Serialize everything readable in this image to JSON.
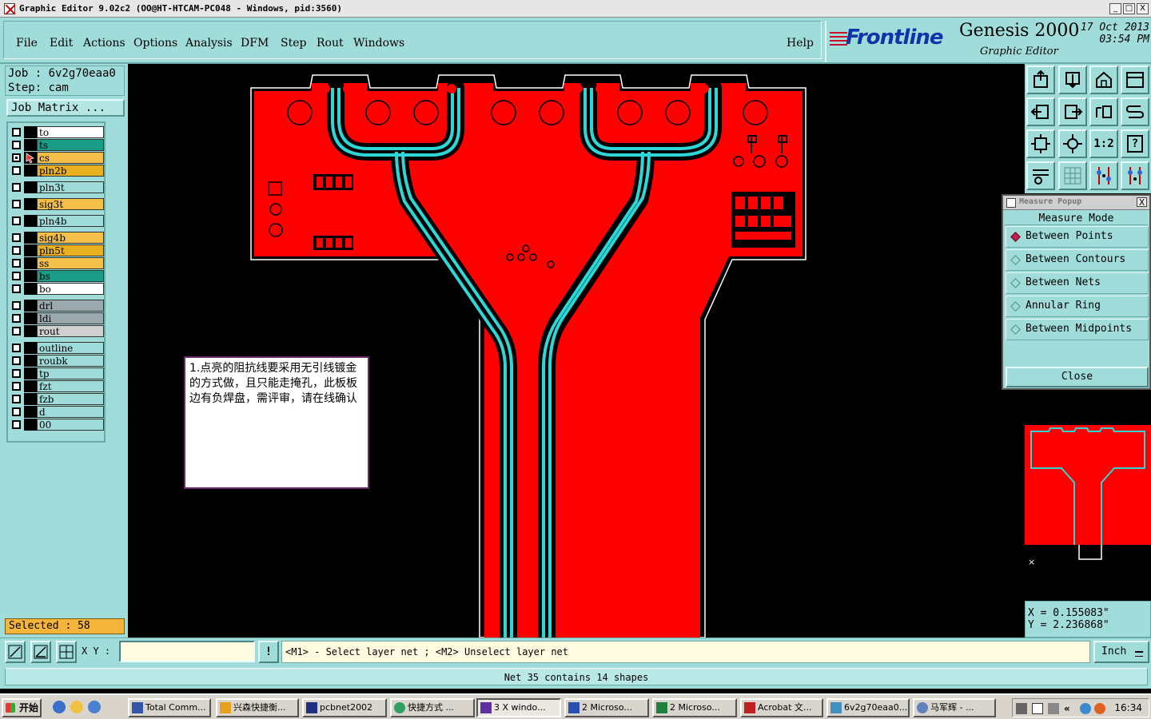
{
  "window": {
    "title": "Graphic Editor 9.02c2 (OO@HT-HTCAM-PC048 - Windows, pid:3560)",
    "min": "_",
    "max": "□",
    "close": "X"
  },
  "menu": {
    "items": [
      "File",
      "Edit",
      "Actions",
      "Options",
      "Analysis",
      "DFM",
      "Step",
      "Rout",
      "Windows"
    ],
    "help": "Help"
  },
  "brand": {
    "logo": "Frontline",
    "product": "Genesis 2000",
    "subtitle": "Graphic Editor",
    "date": "17 Oct 2013",
    "time": "03:54 PM"
  },
  "job": {
    "job_line": "Job : 6v2g70eaa0",
    "step_line": "Step: cam",
    "matrix_label": "Job Matrix ..."
  },
  "layers": [
    {
      "name": "to",
      "color": "#ffffff"
    },
    {
      "name": "ts",
      "color": "#1a9b86"
    },
    {
      "name": "cs",
      "color": "#f5c04a"
    },
    {
      "name": "pln2b",
      "color": "#e8b020"
    },
    {
      "name": "pln3t",
      "color": "#a0ddda"
    },
    {
      "name": "sig3t",
      "color": "#f5c04a"
    },
    {
      "name": "pln4b",
      "color": "#a0ddda"
    },
    {
      "name": "sig4b",
      "color": "#f5c04a"
    },
    {
      "name": "pln5t",
      "color": "#e8b020"
    },
    {
      "name": "ss",
      "color": "#f5c04a"
    },
    {
      "name": "bs",
      "color": "#1a9b86"
    },
    {
      "name": "bo",
      "color": "#ffffff"
    },
    {
      "name": "drl",
      "color": "#9aa9ad"
    },
    {
      "name": "ldi",
      "color": "#9aa9ad"
    },
    {
      "name": "rout",
      "color": "#d0d0d0"
    },
    {
      "name": "outline",
      "color": "#a0ddda"
    },
    {
      "name": "roubk",
      "color": "#a0ddda"
    },
    {
      "name": "tp",
      "color": "#a0ddda"
    },
    {
      "name": "fzt",
      "color": "#a0ddda"
    },
    {
      "name": "fzb",
      "color": "#a0ddda"
    },
    {
      "name": "d",
      "color": "#a0ddda"
    },
    {
      "name": "00",
      "color": "#a0ddda"
    }
  ],
  "selected": "Selected : 58",
  "note": {
    "text": "1.点亮的阻抗线要采用无引线镀金的方式做，且只能走掩孔，此板板边有负焊盘，需评审，请在线确认"
  },
  "measure_popup": {
    "title": "Measure Popup",
    "close_x": "X",
    "mode_heading": "Measure Mode",
    "options": [
      "Between Points",
      "Between Contours",
      "Between Nets",
      "Annular Ring",
      "Between Midpoints"
    ],
    "selected_option": "Between Points",
    "close_label": "Close"
  },
  "tools": {
    "ratio_label": "1:2",
    "help_label": "?"
  },
  "coords": {
    "x": "X = 0.155083\"",
    "y": "Y = 2.236868\""
  },
  "bottom": {
    "xy_label": "X Y :",
    "xy_value": "",
    "info_btn": "!",
    "hint": "<M1> - Select layer net ; <M2> Unselect layer net",
    "units": "Inch"
  },
  "status": "Net 35 contains 14 shapes",
  "taskbar": {
    "start": "开始",
    "buttons": [
      "Total Comm...",
      "兴森快捷衡...",
      "pcbnet2002",
      "快捷方式 ...",
      "3 X windo...",
      "2 Microso...",
      "2 Microso...",
      "Acrobat 文...",
      "6v2g70eaa0...",
      "马军辉 - ..."
    ],
    "clock": "16:34"
  },
  "colors": {
    "panel": "#a0ddda",
    "copper": "#ff0000",
    "trace": "#2fd6d6",
    "outline": "#ffffff"
  }
}
